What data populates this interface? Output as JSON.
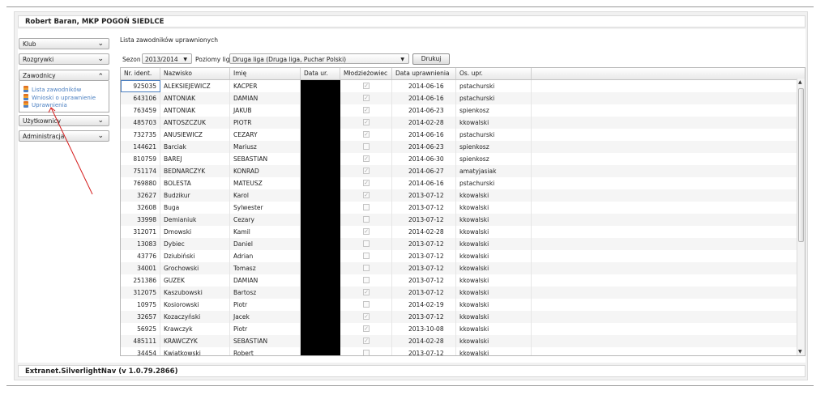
{
  "header": {
    "title": "Robert Baran, MKP POGOŃ SIEDLCE"
  },
  "footer": {
    "text": "Extranet.SilverlightNav (v 1.0.79.2866)"
  },
  "sidebar": {
    "items": [
      {
        "label": "Klub",
        "chevron": "⌄"
      },
      {
        "label": "Rozgrywki",
        "chevron": "⌄"
      },
      {
        "label": "Zawodnicy",
        "chevron": "⌃"
      },
      {
        "label": "Użytkownicy",
        "chevron": "⌄"
      },
      {
        "label": "Administracja",
        "chevron": "⌄"
      }
    ],
    "zawodnicy_links": [
      {
        "label": "Lista zawodników",
        "icon": "players-list-icon"
      },
      {
        "label": "Wnioski o uprawnienie",
        "icon": "requests-icon"
      },
      {
        "label": "Uprawnienia",
        "icon": "permissions-icon"
      }
    ]
  },
  "main": {
    "title": "Lista zawodników uprawnionych",
    "filters": {
      "season_label": "Sezon",
      "season_value": "2013/2014",
      "levels_label": "Poziomy lig",
      "levels_value": "Druga liga (Druga liga, Puchar Polski)",
      "print_label": "Drukuj"
    },
    "columns": [
      "Nr. ident.",
      "Nazwisko",
      "Imię",
      "Data ur.",
      "Młodzieżowiec",
      "Data uprawnienia",
      "Os. upr."
    ],
    "rows": [
      {
        "id": "925035",
        "surname": "ALEKSIEJEWICZ",
        "name": "KACPER",
        "youth": true,
        "date": "2014-06-16",
        "user": "pstachurski"
      },
      {
        "id": "643106",
        "surname": "ANTONIAK",
        "name": "DAMIAN",
        "youth": true,
        "date": "2014-06-16",
        "user": "pstachurski"
      },
      {
        "id": "763459",
        "surname": "ANTONIAK",
        "name": "JAKUB",
        "youth": true,
        "date": "2014-06-23",
        "user": "spienkosz"
      },
      {
        "id": "485703",
        "surname": "ANTOSZCZUK",
        "name": "PIOTR",
        "youth": true,
        "date": "2014-02-28",
        "user": "kkowalski"
      },
      {
        "id": "732735",
        "surname": "ANUSIEWICZ",
        "name": "CEZARY",
        "youth": true,
        "date": "2014-06-16",
        "user": "pstachurski"
      },
      {
        "id": "144621",
        "surname": "Barciak",
        "name": "Mariusz",
        "youth": false,
        "date": "2014-06-23",
        "user": "spienkosz"
      },
      {
        "id": "810759",
        "surname": "BAREJ",
        "name": "SEBASTIAN",
        "youth": true,
        "date": "2014-06-30",
        "user": "spienkosz"
      },
      {
        "id": "751174",
        "surname": "BEDNARCZYK",
        "name": "KONRAD",
        "youth": true,
        "date": "2014-06-27",
        "user": "amatyjasiak"
      },
      {
        "id": "769880",
        "surname": "BOLESTA",
        "name": "MATEUSZ",
        "youth": true,
        "date": "2014-06-16",
        "user": "pstachurski"
      },
      {
        "id": "32627",
        "surname": "Budzikur",
        "name": "Karol",
        "youth": true,
        "date": "2013-07-12",
        "user": "kkowalski"
      },
      {
        "id": "32608",
        "surname": "Buga",
        "name": "Sylwester",
        "youth": false,
        "date": "2013-07-12",
        "user": "kkowalski"
      },
      {
        "id": "33998",
        "surname": "Demianiuk",
        "name": "Cezary",
        "youth": false,
        "date": "2013-07-12",
        "user": "kkowalski"
      },
      {
        "id": "312071",
        "surname": "Dmowski",
        "name": "Kamil",
        "youth": true,
        "date": "2014-02-28",
        "user": "kkowalski"
      },
      {
        "id": "13083",
        "surname": "Dybiec",
        "name": "Daniel",
        "youth": false,
        "date": "2013-07-12",
        "user": "kkowalski"
      },
      {
        "id": "43776",
        "surname": "Dziubiński",
        "name": "Adrian",
        "youth": false,
        "date": "2013-07-12",
        "user": "kkowalski"
      },
      {
        "id": "34001",
        "surname": "Grochowski",
        "name": "Tomasz",
        "youth": false,
        "date": "2013-07-12",
        "user": "kkowalski"
      },
      {
        "id": "251386",
        "surname": "GUZEK",
        "name": "DAMIAN",
        "youth": false,
        "date": "2013-07-12",
        "user": "kkowalski"
      },
      {
        "id": "312075",
        "surname": "Kaszubowski",
        "name": "Bartosz",
        "youth": true,
        "date": "2013-07-12",
        "user": "kkowalski"
      },
      {
        "id": "10975",
        "surname": "Kosiorowski",
        "name": "Piotr",
        "youth": false,
        "date": "2014-02-19",
        "user": "kkowalski"
      },
      {
        "id": "32657",
        "surname": "Kozaczyński",
        "name": "Jacek",
        "youth": true,
        "date": "2013-07-12",
        "user": "kkowalski"
      },
      {
        "id": "56925",
        "surname": "Krawczyk",
        "name": "Piotr",
        "youth": true,
        "date": "2013-10-08",
        "user": "kkowalski"
      },
      {
        "id": "485111",
        "surname": "KRAWCZYK",
        "name": "SEBASTIAN",
        "youth": true,
        "date": "2014-02-28",
        "user": "kkowalski"
      },
      {
        "id": "34454",
        "surname": "Kwiatkowski",
        "name": "Robert",
        "youth": false,
        "date": "2013-07-12",
        "user": "kkowalski"
      }
    ]
  },
  "colors": {
    "accent": "#4a7fc1",
    "annotation": "#d62020"
  }
}
